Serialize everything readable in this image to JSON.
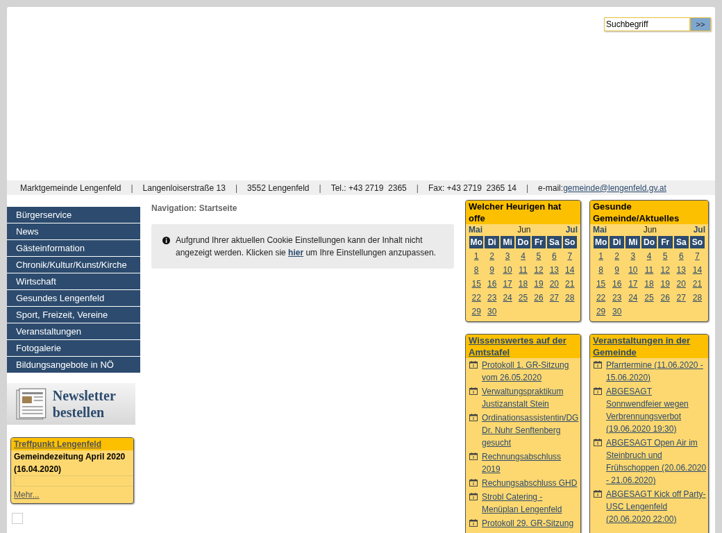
{
  "search": {
    "value": "Suchbegriff",
    "button": ">>"
  },
  "info_bar": {
    "items": [
      "Marktgemeinde Lengenfeld",
      "Langenloiserstraße 13",
      "3552 Lengenfeld",
      "Tel.: +43 2719  2365",
      "Fax: +43 2719  2365 14",
      "e-mail:"
    ],
    "separators": [
      "|",
      "|",
      "|",
      "|",
      "|"
    ],
    "email": "gemeinde@lengenfeld.gv.at"
  },
  "nav": {
    "items": [
      "Bürgerservice",
      "News",
      "Gästeinformation",
      "Chronik/Kultur/Kunst/Kirche",
      "Wirtschaft",
      "Gesundes Lengenfeld",
      "Sport, Freizeit, Vereine",
      "Veranstaltungen",
      "Fotogalerie",
      "Bildungsangebote in NÖ"
    ]
  },
  "newsletter": {
    "text": "Newsletter bestellen"
  },
  "treffpunkt": {
    "title": "Treffpunkt Lengenfeld",
    "entry": "Gemeindezeitung April 2020 (16.04.2020)",
    "more": "Mehr..."
  },
  "breadcrumb": "Navigation: Startseite",
  "cookie_notice": {
    "before": "Aufgrund Ihrer aktuellen Cookie Einstellungen kann der Inhalt nicht angezeigt werden. Klicken sie",
    "link": "hier",
    "after": "um Ihre Einstellungen anzupassen."
  },
  "calendars": [
    {
      "title": "Welcher Heurigen hat offe",
      "prev": "Mai",
      "month": "Jun",
      "next": "Jul",
      "weekdays": [
        "Mo",
        "Di",
        "Mi",
        "Do",
        "Fr",
        "Sa",
        "So"
      ],
      "days": [
        "1",
        "2",
        "3",
        "4",
        "5",
        "6",
        "7",
        "8",
        "9",
        "10",
        "11",
        "12",
        "13",
        "14",
        "15",
        "16",
        "17",
        "18",
        "19",
        "20",
        "21",
        "22",
        "23",
        "24",
        "25",
        "26",
        "27",
        "28",
        "29",
        "30"
      ]
    },
    {
      "title": "Gesunde Gemeinde/Aktuelles",
      "prev": "Mai",
      "month": "Jun",
      "next": "Jul",
      "weekdays": [
        "Mo",
        "Di",
        "Mi",
        "Do",
        "Fr",
        "Sa",
        "So"
      ],
      "days": [
        "1",
        "2",
        "3",
        "4",
        "5",
        "6",
        "7",
        "8",
        "9",
        "10",
        "11",
        "12",
        "13",
        "14",
        "15",
        "16",
        "17",
        "18",
        "19",
        "20",
        "21",
        "22",
        "23",
        "24",
        "25",
        "26",
        "27",
        "28",
        "29",
        "30"
      ]
    }
  ],
  "lists": [
    {
      "title": "Wissenswertes auf der Amtstafel",
      "items": [
        "Protokoll 1. GR-Sitzung vom 26.05.2020",
        "Verwaltungspraktikum Justizanstalt Stein",
        "Ordinationsassistentin/DG Dr. Nuhr Senftenberg gesucht",
        "Rechnungsabschluss 2019",
        "Rechungsabschluss GHD",
        "Strobl Catering - Menüplan Lengenfeld",
        "Protokoll 29. GR-Sitzung"
      ]
    },
    {
      "title": "Veranstaltungen in der Gemeinde",
      "items": [
        "Pfarrtermine (11.06.2020 - 15.06.2020)",
        "ABGESAGT Sonnwendfeier wegen Verbrennungsverbot (19.06.2020 19:30)",
        "ABGESAGT Open Air im Steinbruch und Frühschoppen (20.06.2020 - 21.06.2020)",
        "ABGESAGT Kick off Party- USC Lengenfeld (20.06.2020 22:00)"
      ]
    }
  ]
}
